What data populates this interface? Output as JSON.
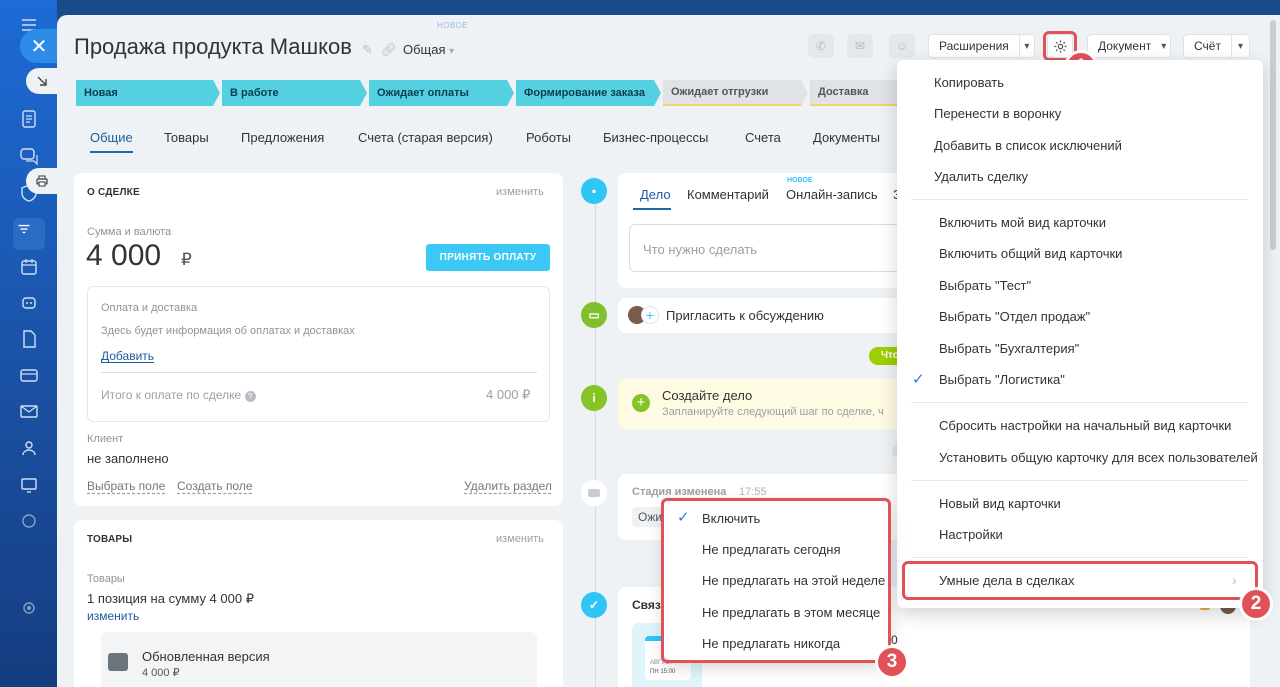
{
  "header": {
    "new_label": "НОВОЕ",
    "title": "Продажа продукта Машков",
    "category": "Общая",
    "extensions_label": "Расширения",
    "document_label": "Документ",
    "invoice_label": "Счёт"
  },
  "stages": [
    {
      "label": "Новая",
      "state": "active"
    },
    {
      "label": "В работе",
      "state": "active"
    },
    {
      "label": "Ожидает оплаты",
      "state": "active"
    },
    {
      "label": "Формирование заказа",
      "state": "active"
    },
    {
      "label": "Ожидает отгрузки",
      "state": "inactive"
    },
    {
      "label": "Доставка",
      "state": "inactive"
    }
  ],
  "tabs": [
    "Общие",
    "Товары",
    "Предложения",
    "Счета (старая версия)",
    "Роботы",
    "Бизнес-процессы",
    "Счета",
    "Документы"
  ],
  "deal_card": {
    "title": "О СДЕЛКЕ",
    "edit": "изменить",
    "sum_label": "Сумма и валюта",
    "sum_value": "4 000",
    "currency": "₽",
    "pay_button": "ПРИНЯТЬ ОПЛАТУ",
    "payment_title": "Оплата и доставка",
    "payment_hint": "Здесь будет информация об оплатах и доставках",
    "add_link": "Добавить",
    "total_label": "Итого к оплате по сделке",
    "total_value": "4 000 ₽",
    "client_label": "Клиент",
    "client_value": "не заполнено",
    "select_field": "Выбрать поле",
    "create_field": "Создать поле",
    "delete_section": "Удалить раздел"
  },
  "goods_card": {
    "title": "ТОВАРЫ",
    "edit": "изменить",
    "goods_label": "Товары",
    "goods_summary": "1 позиция на сумму 4 000 ₽",
    "change_link": "изменить",
    "item_name": "Обновленная версия",
    "item_price": "4 000 ₽"
  },
  "timeline": {
    "tab_task": "Дело",
    "tab_comment": "Комментарий",
    "tab_online": "Онлайн-запись",
    "tab_online_badge": "НОВОЕ",
    "tab_more": "З",
    "task_placeholder": "Что нужно сделать",
    "invite": "Пригласить к обсуждению",
    "green_pill": "Что",
    "create_task_title": "Создайте дело",
    "create_task_hint": "Запланируйте следующий шаг по сделке, ч",
    "stage_changed": "Стадия изменена",
    "stage_time": "17:55",
    "stage_chip": "Ожи",
    "linked_title": "Связ",
    "calendar_label": "АВГУСТ",
    "calendar_sub": "ПН 15:00",
    "right_digit": "0"
  },
  "settings_menu": {
    "group1": [
      "Копировать",
      "Перенести в воронку",
      "Добавить в список исключений",
      "Удалить сделку"
    ],
    "group2": [
      "Включить мой вид карточки",
      "Включить общий вид карточки",
      "Выбрать \"Тест\"",
      "Выбрать \"Отдел продаж\"",
      "Выбрать \"Бухгалтерия\"",
      "Выбрать \"Логистика\""
    ],
    "group3": [
      "Сбросить настройки на начальный вид карточки",
      "Установить общую карточку для всех пользователей"
    ],
    "group4": [
      "Новый вид карточки",
      "Настройки"
    ],
    "smart_tasks": "Умные дела в сделках"
  },
  "submenu": [
    "Включить",
    "Не предлагать сегодня",
    "Не предлагать на этой неделе",
    "Не предлагать в этом месяце",
    "Не предлагать никогда"
  ],
  "badges": [
    "1",
    "2",
    "3"
  ],
  "colors": {
    "accent": "#3bc8f5",
    "stage_active": "#55d0e0",
    "highlight": "#e05158",
    "link": "#1c5aa0"
  }
}
